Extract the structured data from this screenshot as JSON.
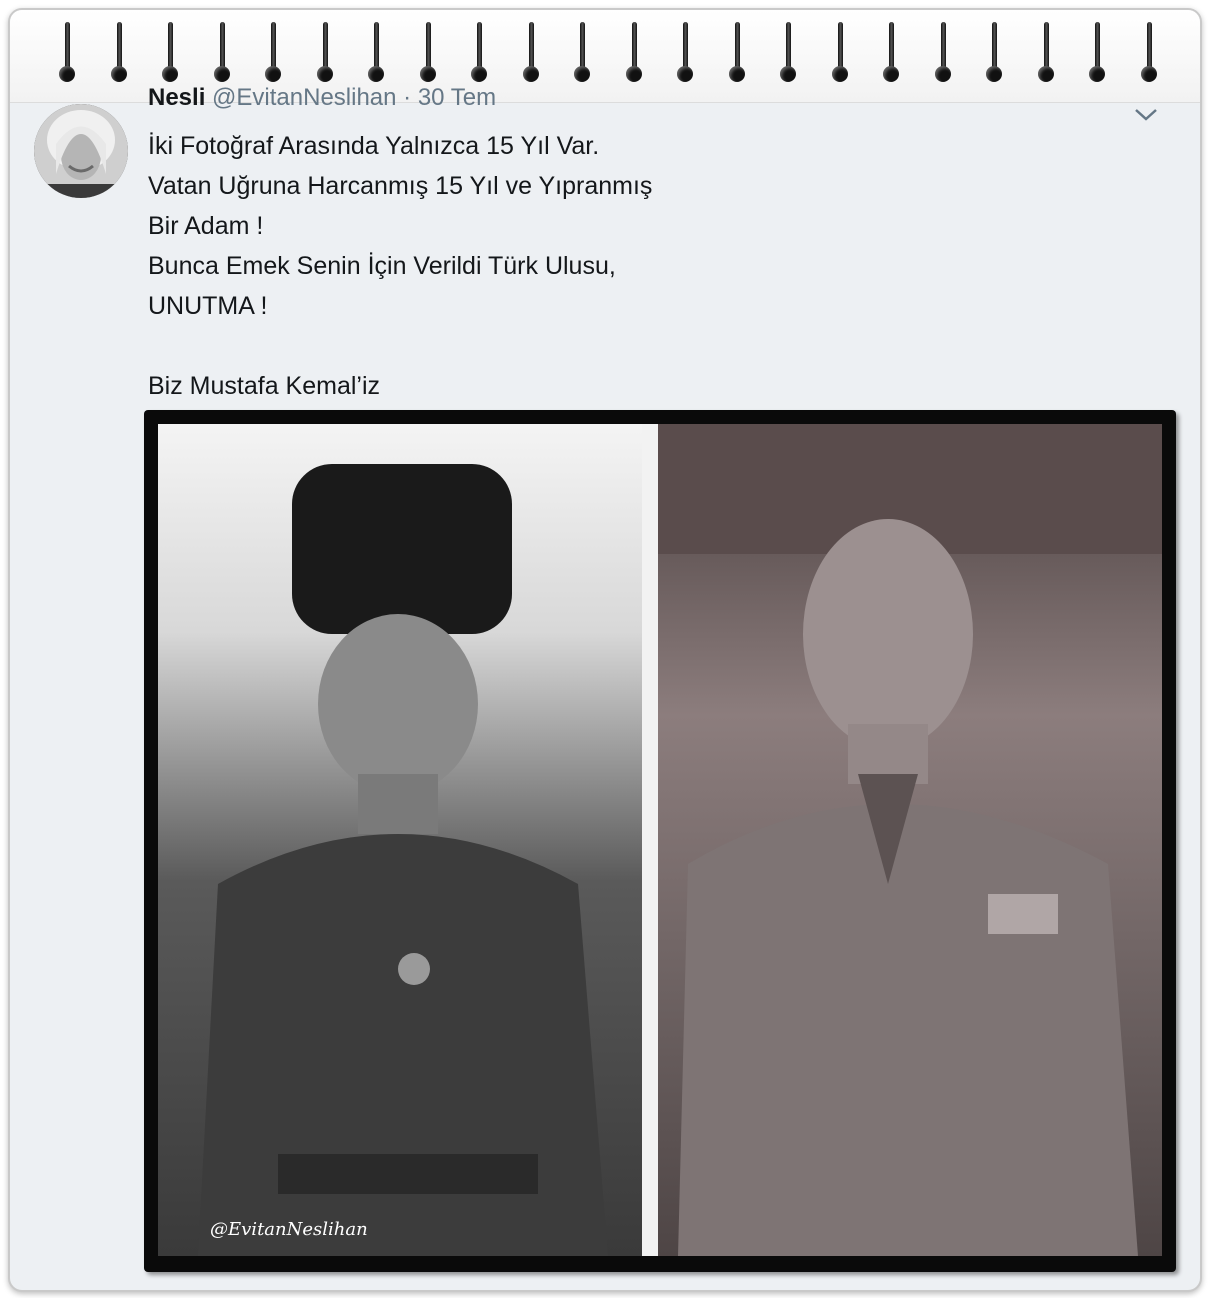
{
  "tweet": {
    "author_name": "Nesli",
    "handle": "@EvitanNeslihan",
    "date": "· 30 Tem",
    "caret_icon": "chevron-down-icon",
    "lines": [
      "İki Fotoğraf Arasında Yalnızca 15 Yıl Var.",
      "Vatan Uğruna Harcanmış 15 Yıl ve Yıpranmış",
      "Bir Adam !",
      "Bunca Emek Senin İçin Verildi Türk Ulusu,",
      "UNUTMA !",
      "",
      "Biz Mustafa Kemal’iz"
    ],
    "media": {
      "watermark": "@EvitanNeslihan"
    }
  },
  "colors": {
    "background": "#edf0f3",
    "text": "#14171a",
    "muted": "#657786"
  }
}
